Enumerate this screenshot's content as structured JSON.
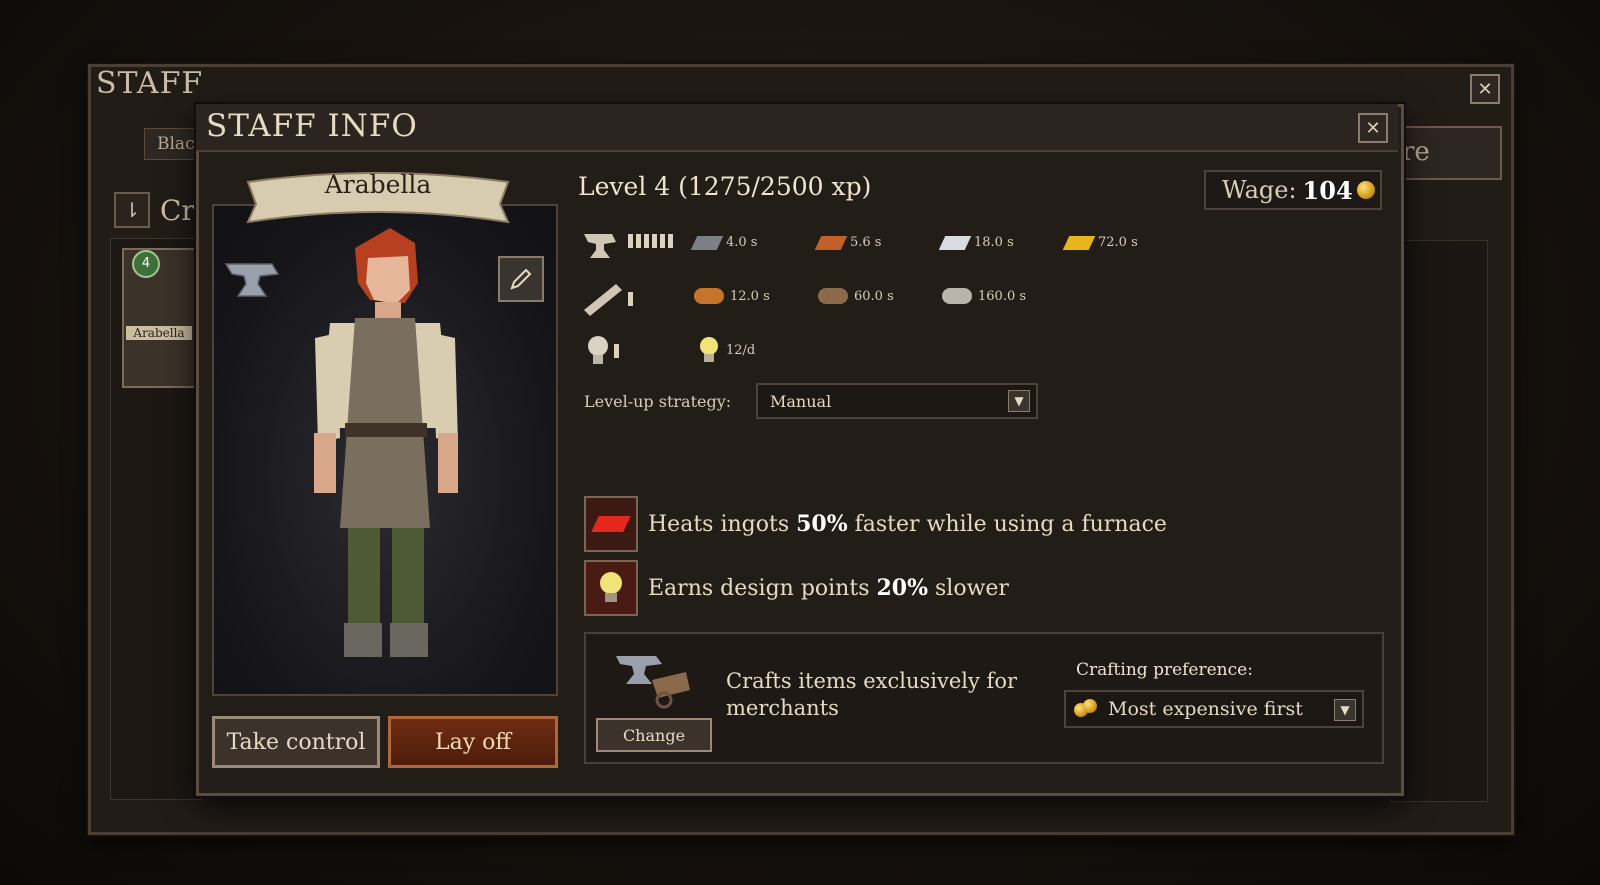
{
  "staff_window": {
    "title": "STAFF",
    "tab_partial": "Blac",
    "right_button_partial": "re",
    "header_partial": "Cr",
    "card": {
      "level": "4",
      "name": "Arabella"
    }
  },
  "staff_info": {
    "title": "STAFF INFO",
    "name": "Arabella",
    "level_text": "Level 4 (1275/2500 xp)",
    "wage": {
      "label": "Wage:",
      "value": "104"
    },
    "skills": [
      {
        "skill": "smithing",
        "pips": 6,
        "stats": [
          {
            "material": "iron-ingot",
            "value": "4.0 s",
            "color": "#7c7f86"
          },
          {
            "material": "copper-ingot",
            "value": "5.6 s",
            "color": "#c0612a"
          },
          {
            "material": "silver-ingot",
            "value": "18.0 s",
            "color": "#d8dce2"
          },
          {
            "material": "gold-ingot",
            "value": "72.0 s",
            "color": "#e8b51c"
          }
        ]
      },
      {
        "skill": "woodworking",
        "pips": 1,
        "stats": [
          {
            "material": "pine-log",
            "value": "12.0 s",
            "color": "#c5742c"
          },
          {
            "material": "oak-log",
            "value": "60.0 s",
            "color": "#8a6a4a"
          },
          {
            "material": "birch-log",
            "value": "160.0 s",
            "color": "#b8b4ac"
          }
        ]
      },
      {
        "skill": "design",
        "pips": 1,
        "stats": [
          {
            "material": "design-point",
            "value": "12/d",
            "color": "#f2e27a"
          }
        ]
      }
    ],
    "strategy": {
      "label": "Level-up strategy:",
      "value": "Manual"
    },
    "traits": [
      {
        "icon": "hot-ingot-icon",
        "pre": "Heats ingots ",
        "bold": "50%",
        "post": " faster while using a furnace"
      },
      {
        "icon": "lightbulb-icon",
        "pre": "Earns design points ",
        "bold": "20%",
        "post": " slower"
      }
    ],
    "preference": {
      "crafts_text": "Crafts items exclusively for merchants",
      "change_label": "Change",
      "label": "Crafting preference:",
      "value": "Most expensive first"
    },
    "buttons": {
      "take_control": "Take control",
      "lay_off": "Lay off"
    }
  }
}
